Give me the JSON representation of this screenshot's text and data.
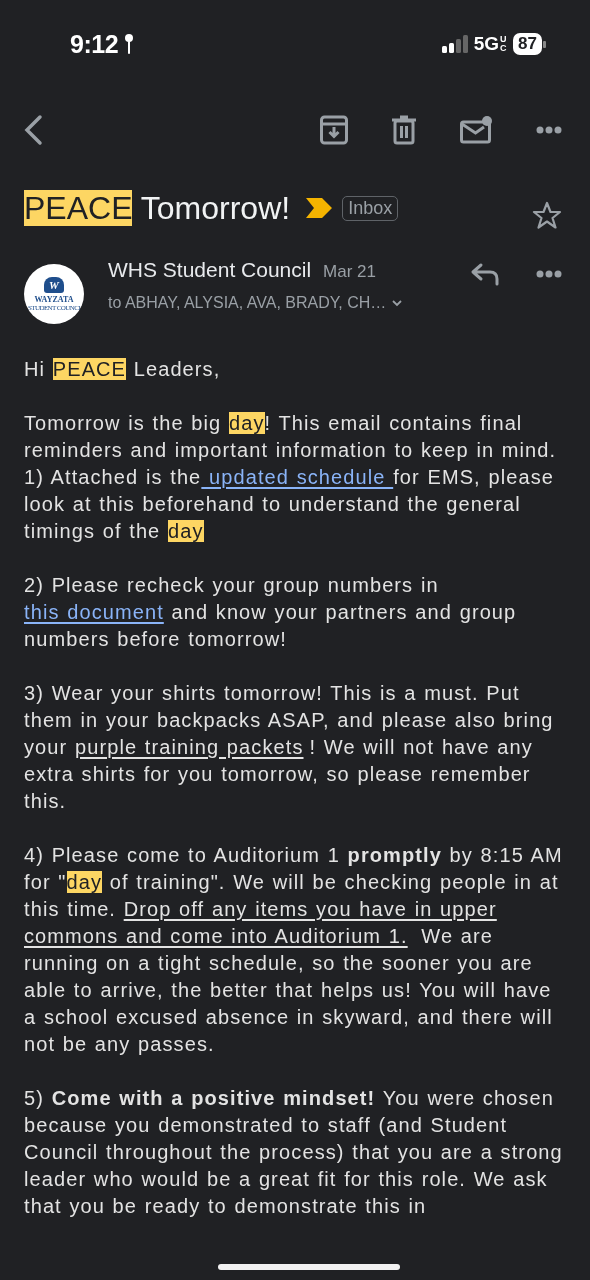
{
  "status_bar": {
    "time": "9:12",
    "network": "5G",
    "network_sub": "UC",
    "battery": "87"
  },
  "subject": [
    {
      "kind": "highlight",
      "text": "PEACE"
    },
    {
      "kind": "text",
      "text": " Tomorrow!"
    }
  ],
  "important": true,
  "label": "Inbox",
  "starred": false,
  "sender": {
    "name": "WHS Student Council",
    "date": "Mar 21",
    "recipients": "to ABHAY, ALYSIA, AVA, BRADY, CH…",
    "logo_mark": "W",
    "logo_name": "WAYZATA",
    "logo_sub": "STUDENT COUNCI"
  },
  "body": [
    [
      [
        {
          "kind": "text",
          "text": "Hi "
        },
        {
          "kind": "highlight",
          "text": "PEACE"
        },
        {
          "kind": "text",
          "text": " Leaders,"
        }
      ]
    ],
    [
      [
        {
          "kind": "text",
          "text": "Tomorrow is the big "
        },
        {
          "kind": "highlight",
          "text": "day"
        },
        {
          "kind": "text",
          "text": "! This email contains final reminders and important information to keep in mind."
        }
      ],
      [
        {
          "kind": "text",
          "text": "1) Attached is the"
        },
        {
          "kind": "link",
          "text": " updated schedule "
        },
        {
          "kind": "text",
          "text": "for EMS, please look at this beforehand to understand the general timings of the "
        },
        {
          "kind": "highlight",
          "text": "day"
        }
      ]
    ],
    [
      [
        {
          "kind": "text",
          "text": "2) Please recheck your group numbers in "
        },
        {
          "kind": "link",
          "text": "this document"
        },
        {
          "kind": "text",
          "text": " and know your partners and group numbers before tomorrow!"
        }
      ]
    ],
    [
      [
        {
          "kind": "text",
          "text": "3) Wear your shirts tomorrow! This is a must. Put them in your backpacks ASAP, and please also bring your "
        },
        {
          "kind": "underline",
          "text": "purple training packets"
        },
        {
          "kind": "text",
          "text": "! We will not have any extra shirts for you tomorrow, so please remember this."
        }
      ]
    ],
    [
      [
        {
          "kind": "text",
          "text": "4) Please come to Auditorium 1 "
        },
        {
          "kind": "bold",
          "text": "promptly"
        },
        {
          "kind": "text",
          "text": " by 8:15 AM for \""
        },
        {
          "kind": "highlight",
          "text": "day"
        },
        {
          "kind": "text",
          "text": " of training\". We will be checking people in at this time. "
        },
        {
          "kind": "underline",
          "text": "Drop off any items you have in upper"
        },
        {
          "kind": "underline",
          "text": "commons and come into Auditorium 1."
        },
        {
          "kind": "text",
          "text": " We are running on a tight schedule, so the sooner you are able to arrive, the better that helps us! You will have a school excused absence in skyward, and there will not be any passes."
        }
      ]
    ],
    [
      [
        {
          "kind": "text",
          "text": "5)  "
        },
        {
          "kind": "bold",
          "text": "Come with a positive mindset!"
        },
        {
          "kind": "text",
          "text": " You were chosen because you demonstrated to staff (and Student Council throughout the process) that you are a strong leader who would be a great fit for this role. We ask that you be ready to demonstrate this in"
        }
      ]
    ]
  ]
}
